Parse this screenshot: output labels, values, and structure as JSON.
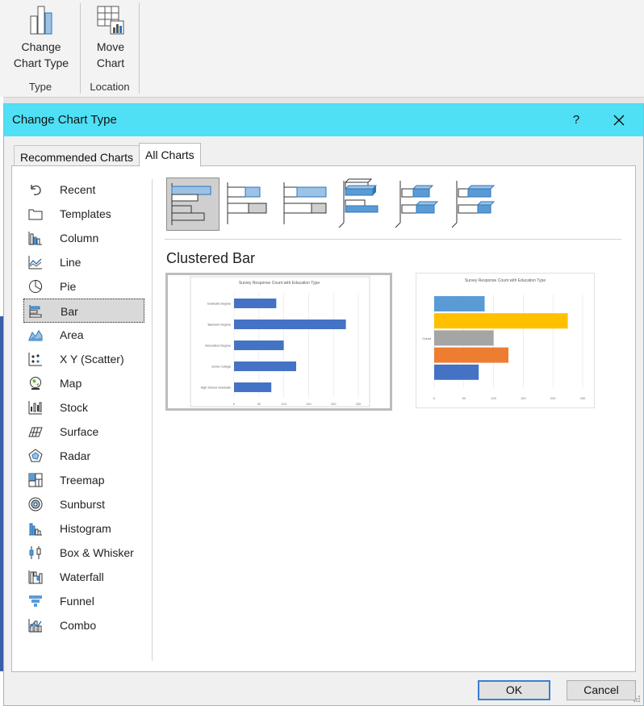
{
  "ribbon": {
    "groups": [
      {
        "button_label_1": "Change",
        "button_label_2": "Chart Type",
        "caption": "Type"
      },
      {
        "button_label_1": "Move",
        "button_label_2": "Chart",
        "caption": "Location"
      }
    ]
  },
  "dialog": {
    "title": "Change Chart Type",
    "help": "?",
    "tabs": [
      {
        "label": "Recommended Charts",
        "active": false
      },
      {
        "label": "All Charts",
        "active": true
      }
    ],
    "chart_types": [
      {
        "label": "Recent",
        "icon": "undo-icon"
      },
      {
        "label": "Templates",
        "icon": "folder-icon"
      },
      {
        "label": "Column",
        "icon": "column-chart-icon"
      },
      {
        "label": "Line",
        "icon": "line-chart-icon"
      },
      {
        "label": "Pie",
        "icon": "pie-chart-icon"
      },
      {
        "label": "Bar",
        "icon": "bar-chart-icon",
        "selected": true
      },
      {
        "label": "Area",
        "icon": "area-chart-icon"
      },
      {
        "label": "X Y (Scatter)",
        "icon": "scatter-chart-icon"
      },
      {
        "label": "Map",
        "icon": "map-chart-icon"
      },
      {
        "label": "Stock",
        "icon": "stock-chart-icon"
      },
      {
        "label": "Surface",
        "icon": "surface-chart-icon"
      },
      {
        "label": "Radar",
        "icon": "radar-chart-icon"
      },
      {
        "label": "Treemap",
        "icon": "treemap-chart-icon"
      },
      {
        "label": "Sunburst",
        "icon": "sunburst-chart-icon"
      },
      {
        "label": "Histogram",
        "icon": "histogram-chart-icon"
      },
      {
        "label": "Box & Whisker",
        "icon": "box-whisker-chart-icon"
      },
      {
        "label": "Waterfall",
        "icon": "waterfall-chart-icon"
      },
      {
        "label": "Funnel",
        "icon": "funnel-chart-icon"
      },
      {
        "label": "Combo",
        "icon": "combo-chart-icon"
      }
    ],
    "subtype_title": "Clustered Bar",
    "ok_label": "OK",
    "cancel_label": "Cancel"
  },
  "colors": {
    "titlebar": "#4fe0f5",
    "bar_blue": "#4472c4",
    "light_blue": "#5b9bd5",
    "gold": "#ffc000",
    "gray": "#a5a5a5",
    "orange": "#ed7d31"
  },
  "chart_data": [
    {
      "type": "bar",
      "title": "Survey Response Count with Education Type",
      "categories": [
        "Graduate Degree",
        "Bachelor Degree",
        "Associates Degree",
        "Some College",
        "High School Graduate"
      ],
      "values": [
        85,
        225,
        100,
        125,
        75
      ],
      "xlim": [
        0,
        250
      ],
      "xticks": [
        0,
        50,
        100,
        150,
        200,
        250
      ],
      "series_color": "#4472c4"
    },
    {
      "type": "bar",
      "title": "Survey Response Count with Education Type",
      "categories": [
        "Count"
      ],
      "series": [
        {
          "values": [
            85
          ],
          "color": "#5b9bd5"
        },
        {
          "values": [
            225
          ],
          "color": "#ffc000"
        },
        {
          "values": [
            100
          ],
          "color": "#a5a5a5"
        },
        {
          "values": [
            125
          ],
          "color": "#ed7d31"
        },
        {
          "values": [
            75
          ],
          "color": "#4472c4"
        }
      ],
      "xlim": [
        0,
        250
      ],
      "xticks": [
        0,
        50,
        100,
        150,
        200,
        250
      ]
    }
  ]
}
